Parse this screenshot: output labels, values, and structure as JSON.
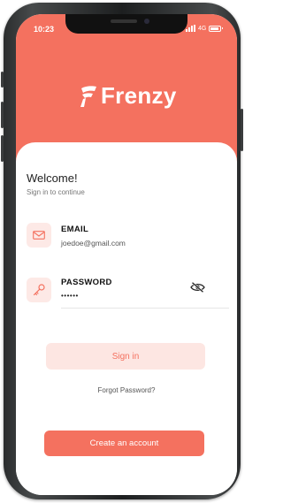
{
  "status_bar": {
    "time": "10:23",
    "network": "4G"
  },
  "brand": {
    "name": "Frenzy",
    "color": "#f4715f"
  },
  "welcome": {
    "title": "Welcome!",
    "subtitle": "Sign in to continue"
  },
  "email": {
    "label": "EMAIL",
    "value": "joedoe@gmail.com",
    "icon": "mail-icon"
  },
  "password": {
    "label": "PASSWORD",
    "value": "••••••",
    "icon": "key-icon",
    "toggle_icon": "eye-slash-icon"
  },
  "actions": {
    "sign_in_label": "Sign in",
    "forgot_label": "Forgot Password?",
    "create_account_label": "Create an account"
  }
}
